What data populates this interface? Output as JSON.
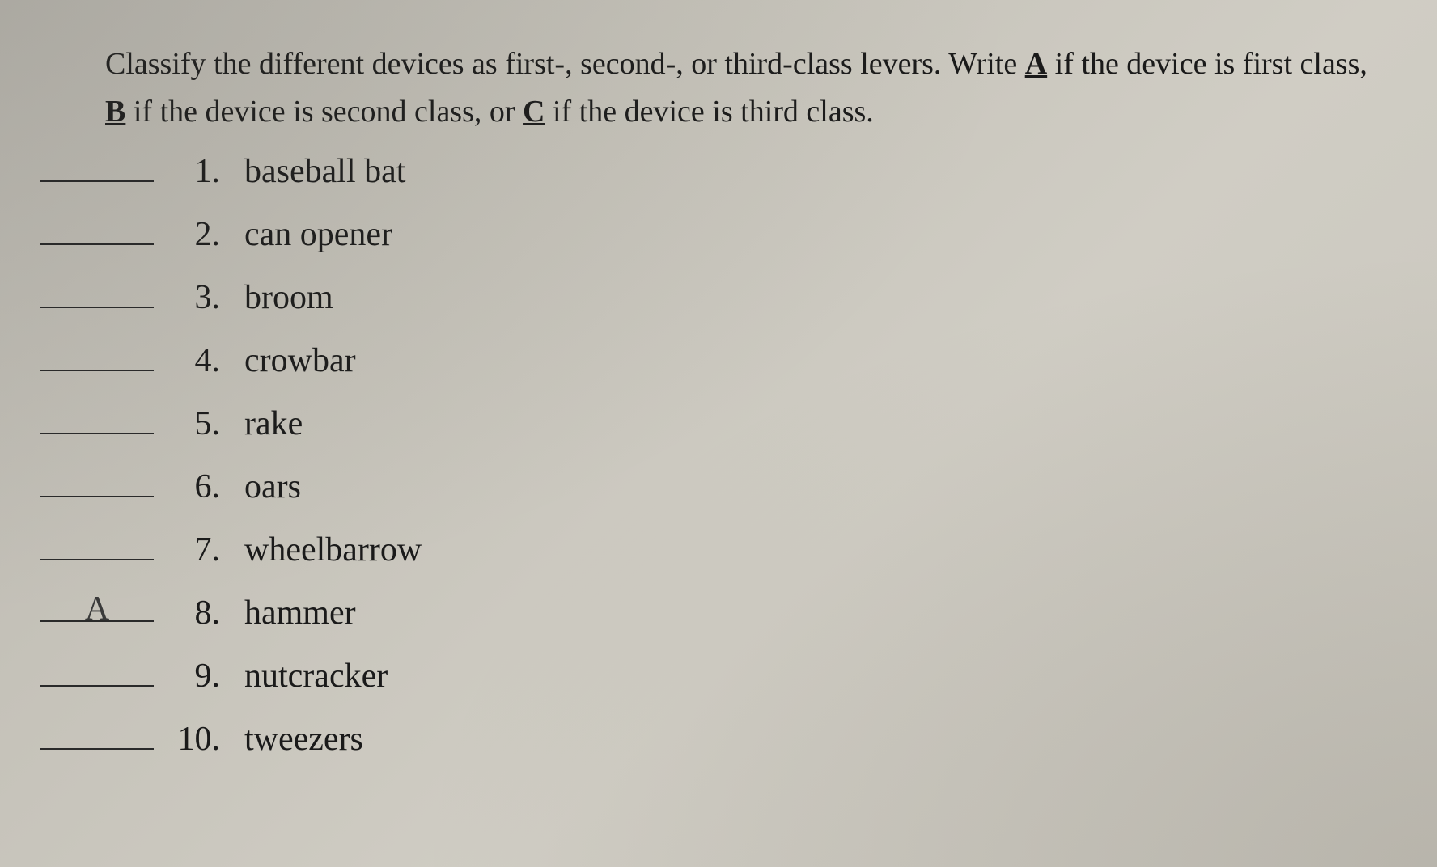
{
  "instructions": {
    "line1": "Classify the different devices as first-, second-, or third-class levers. Write ",
    "optionA": "A",
    "line2": " if the device is first class, ",
    "optionB": "B",
    "line3": " if the device is second class, or ",
    "optionC": "C",
    "line4": " if the device is third class."
  },
  "items": [
    {
      "number": "1.",
      "text": "baseball bat",
      "answer": ""
    },
    {
      "number": "2.",
      "text": "can opener",
      "answer": ""
    },
    {
      "number": "3.",
      "text": "broom",
      "answer": ""
    },
    {
      "number": "4.",
      "text": "crowbar",
      "answer": ""
    },
    {
      "number": "5.",
      "text": "rake",
      "answer": ""
    },
    {
      "number": "6.",
      "text": "oars",
      "answer": ""
    },
    {
      "number": "7.",
      "text": "wheelbarrow",
      "answer": ""
    },
    {
      "number": "8.",
      "text": "hammer",
      "answer": "A"
    },
    {
      "number": "9.",
      "text": "nutcracker",
      "answer": ""
    },
    {
      "number": "10.",
      "text": "tweezers",
      "answer": ""
    }
  ]
}
